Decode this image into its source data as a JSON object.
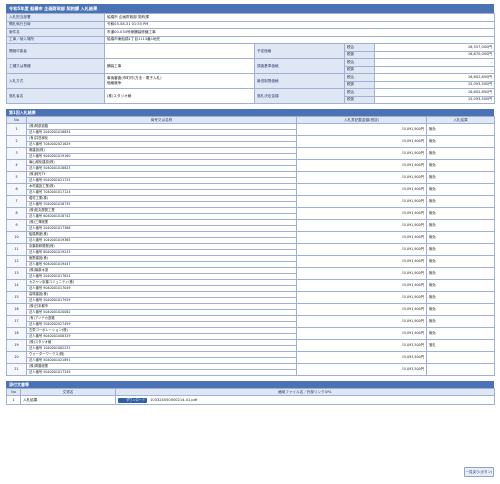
{
  "page_title": "令和5年度 船橋市 企画財政部 契約課 入札結果",
  "info": {
    "dept_label": "入札担当部署",
    "dept_value": "船橋市 企画財政部 契約課",
    "date_label": "開札執行日時",
    "date_value": "令和05-08-31 01:55 PM",
    "case_label": "案件名",
    "case_value": "市道00-034号線舗装修繕工事",
    "place_label": "工事／納入場所",
    "place_value": "船橋市東船橋1丁目1113番1地先",
    "qualify_label": "開緒可能者",
    "planned_label": "予定価格",
    "kind_label": "工種又は業種",
    "kind_value": "舗装工事",
    "survey_label": "調査基準価格",
    "method_label": "入札方式",
    "method_value": "事後審査(市町村(方法・電子入札)",
    "method_value2": "価格競争",
    "winprice_label": "最低制限価格",
    "winner_label": "落札者名",
    "winner_value": "(株)スタジオ綾",
    "decided_label": "落札決定金額",
    "tax_in": "税込",
    "tax_ex": "税抜",
    "planned_in": "18,557,000円",
    "planned_ex": "16,870,000円",
    "survey_in": "-",
    "survey_ex": "-",
    "winprice_in": "16,602,850円",
    "winprice_ex": "15,093,500円",
    "decided_in": "16,602,850円",
    "decided_ex": "15,093,500円"
  },
  "bid_section_title": "第1回入札結果",
  "bid_headers": {
    "no": "No",
    "name": "商号又は名称",
    "amount": "入札書記載金額(税抜)",
    "result": "入札結果"
  },
  "bids": [
    {
      "no": "1",
      "name": "(株)阿部道路",
      "corp": "法人番号 2040001016634",
      "amount": "15,091,900円",
      "result": "無効"
    },
    {
      "no": "2",
      "name": "(有)井荘緑化",
      "corp": "法人番号 7040002021629",
      "amount": "15,091,900円",
      "result": "無効"
    },
    {
      "no": "3",
      "name": "菅建設(株)",
      "corp": "法人番号 9040001019160",
      "amount": "15,091,900円",
      "result": "無効"
    },
    {
      "no": "4",
      "name": "篠山緑化建設(株)",
      "corp": "法人番号 5040001018823",
      "amount": "15,091,900円",
      "result": "無効"
    },
    {
      "no": "5",
      "name": "(株)姉光TY",
      "corp": "法人番号 5040001021725",
      "amount": "15,091,900円",
      "result": "無効"
    },
    {
      "no": "6",
      "name": "木村建設工業(株)",
      "corp": "法人番号 7040001017124",
      "amount": "15,091,900円",
      "result": "無効"
    },
    {
      "no": "7",
      "name": "堀村工業(株)",
      "corp": "法人番号 7040001016735",
      "amount": "15,091,900円",
      "result": "無効"
    },
    {
      "no": "8",
      "name": "(株)松丸開発工業",
      "corp": "法人番号 6040001018742",
      "amount": "15,091,900円",
      "result": "無効"
    },
    {
      "no": "9",
      "name": "(株)三澤総業",
      "corp": "法人番号 2040001017368",
      "amount": "15,091,900円",
      "result": "無効"
    },
    {
      "no": "10",
      "name": "船橋興産(株)",
      "corp": "法人番号 1040001019365",
      "amount": "15,091,900円",
      "result": "無効"
    },
    {
      "no": "11",
      "name": "京葉新和開発(株)",
      "corp": "法人番号 8040001019243",
      "amount": "15,091,900円",
      "result": "無効"
    },
    {
      "no": "12",
      "name": "飯野建設(株)",
      "corp": "法人番号 9040001019447",
      "amount": "15,091,900円",
      "result": "無効"
    },
    {
      "no": "13",
      "name": "(株)篠原水道",
      "corp": "法人番号 2040001017624",
      "amount": "15,091,900円",
      "result": "無効"
    },
    {
      "no": "14",
      "name": "カネヤン京葉コミュニティ(株)",
      "corp": "法人番号 9040001017049",
      "amount": "15,091,900円",
      "result": "無効"
    },
    {
      "no": "15",
      "name": "高塚建設(株)",
      "corp": "法人番号 3040001017929",
      "amount": "15,091,900円",
      "result": "無効"
    },
    {
      "no": "16",
      "name": "(株)日本都市",
      "corp": "法人番号 5040001020082",
      "amount": "15,091,900円",
      "result": "無効"
    },
    {
      "no": "17",
      "name": "(有)アンテカ道路",
      "corp": "法人番号 7040002027459",
      "amount": "15,091,900円",
      "result": "無効"
    },
    {
      "no": "18",
      "name": "古栄コーポレーション(株)",
      "corp": "法人番号 9040001008329",
      "amount": "15,091,900円",
      "result": "無効"
    },
    {
      "no": "19",
      "name": "(株)スタジオ綾",
      "corp": "法人番号 1040001082233",
      "amount": "15,093,500円",
      "result": "落札"
    },
    {
      "no": "20",
      "name": "ウォーターワークス(株)",
      "corp": "法人番号 5040001021891",
      "amount": "15,093,500円",
      "result": ""
    },
    {
      "no": "21",
      "name": "(株)斉藤総業",
      "corp": "法人番号 5040001017349",
      "amount": "15,093,500円",
      "result": ""
    }
  ],
  "doc_section_title": "添付文書等",
  "doc_headers": {
    "no": "No",
    "name": "文書名",
    "file": "格納ファイル名／外部リンクURL"
  },
  "docs": [
    {
      "no": "1",
      "name": "入札結果",
      "button": "ダウンロード",
      "file": "103324050000214-01.pdf"
    }
  ],
  "bottom_button": "一覧戻り(ボタン)"
}
